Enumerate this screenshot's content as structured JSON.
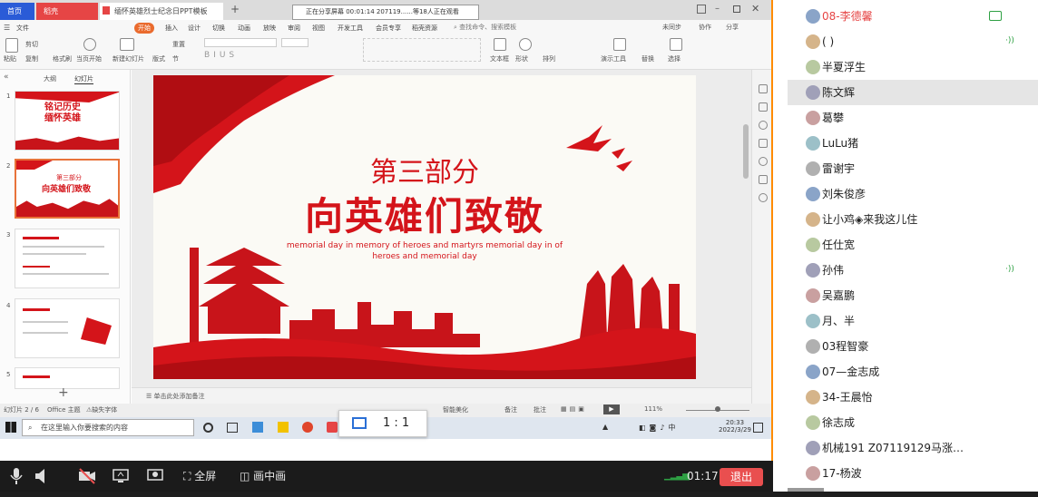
{
  "app": {
    "tabs": [
      "首页",
      "稻壳",
      "缅怀英雄烈士纪念日PPT模板"
    ],
    "share_banner": "正在分享屏幕    00:01:14    207119......等18人正在观看"
  },
  "ribbon": {
    "menu_tabs": [
      "文件",
      "开始",
      "插入",
      "设计",
      "切换",
      "动画",
      "放映",
      "审阅",
      "视图",
      "开发工具",
      "会员专享",
      "稻壳资源"
    ],
    "search": "查找命令、搜索模板",
    "right": [
      "未同步",
      "协作",
      "分享"
    ],
    "buttons": [
      "粘贴",
      "剪切",
      "复制",
      "格式刷",
      "当页开始",
      "新建幻灯片",
      "版式",
      "节",
      "重置",
      "文本框",
      "形状",
      "排列",
      "演示工具",
      "替换",
      "选择"
    ]
  },
  "panel": {
    "tabs": [
      "大纲",
      "幻灯片"
    ]
  },
  "thumbs": [
    {
      "num": "1",
      "line1": "铭记历史",
      "line2": "缅怀英雄"
    },
    {
      "num": "2",
      "line1": "第三部分",
      "line2": "向英雄们致敬"
    },
    {
      "num": "3",
      "line1": "",
      "line2": ""
    },
    {
      "num": "4",
      "line1": "",
      "line2": ""
    },
    {
      "num": "5",
      "line1": "",
      "line2": ""
    }
  ],
  "slide": {
    "subtitle": "第三部分",
    "title": "向英雄们致敬",
    "english": "memorial day in memory of heroes and martyrs memorial day in of heroes and memorial day"
  },
  "notes_placeholder": "单击此处添加备注",
  "status": {
    "slide_info": "幻灯片 2 / 6",
    "theme": "Office 主题",
    "font_missing": "缺失字体",
    "smart": "智能美化",
    "notes": "备注",
    "comment": "批注",
    "zoom": "111%"
  },
  "taskbar": {
    "search_placeholder": "在这里输入你要搜索的内容",
    "time": "20:33",
    "date": "2022/3/29"
  },
  "zoom_control": {
    "label": "1 : 1"
  },
  "meeting": {
    "fullscreen": "全屏",
    "pip": "画中画",
    "duration": "01:17",
    "leave": "退出"
  },
  "participants": [
    {
      "name": "08-李德馨",
      "accent": true,
      "speaking": false
    },
    {
      "name": "(    )",
      "accent": false,
      "speaking": true
    },
    {
      "name": "半夏浮生",
      "accent": false,
      "speaking": false
    },
    {
      "name": "陈文辉",
      "accent": false,
      "speaking": false,
      "highlight": true
    },
    {
      "name": "葛攀",
      "accent": false,
      "speaking": false
    },
    {
      "name": "LuLu猪",
      "accent": false,
      "speaking": false
    },
    {
      "name": "雷谢宇",
      "accent": false,
      "speaking": false
    },
    {
      "name": "刘朱俊彦",
      "accent": false,
      "speaking": false
    },
    {
      "name": "让小鸡◈来我这儿住",
      "accent": false,
      "speaking": false
    },
    {
      "name": "任仕宽",
      "accent": false,
      "speaking": false
    },
    {
      "name": "孙伟",
      "accent": false,
      "speaking": true
    },
    {
      "name": "吴嘉鹏",
      "accent": false,
      "speaking": false
    },
    {
      "name": "月、半",
      "accent": false,
      "speaking": false
    },
    {
      "name": "03程智豪",
      "accent": false,
      "speaking": false
    },
    {
      "name": "07—金志成",
      "accent": false,
      "speaking": false
    },
    {
      "name": "34-王晨怡",
      "accent": false,
      "speaking": false
    },
    {
      "name": "徐志成",
      "accent": false,
      "speaking": false
    },
    {
      "name": "机械191 Z07119129马涨…",
      "accent": false,
      "speaking": false
    },
    {
      "name": "17-杨波",
      "accent": false,
      "speaking": false
    }
  ],
  "colors": {
    "accent": "#e64545",
    "brand_orange": "#ea6b2e",
    "slide_red": "#d4141a",
    "speaking_green": "#2ea043"
  }
}
